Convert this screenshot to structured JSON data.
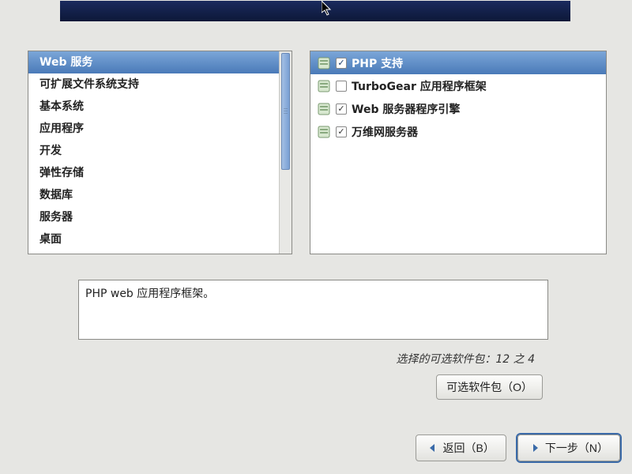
{
  "categories": [
    {
      "label": "Web 服务",
      "selected": true
    },
    {
      "label": "可扩展文件系统支持",
      "selected": false
    },
    {
      "label": "基本系统",
      "selected": false
    },
    {
      "label": "应用程序",
      "selected": false
    },
    {
      "label": "开发",
      "selected": false
    },
    {
      "label": "弹性存储",
      "selected": false
    },
    {
      "label": "数据库",
      "selected": false
    },
    {
      "label": "服务器",
      "selected": false
    },
    {
      "label": "桌面",
      "selected": false
    }
  ],
  "packages": [
    {
      "label": "PHP 支持",
      "checked": true,
      "selected": true
    },
    {
      "label": "TurboGear 应用程序框架",
      "checked": false,
      "selected": false
    },
    {
      "label": "Web 服务器程序引擎",
      "checked": true,
      "selected": false
    },
    {
      "label": "万维网服务器",
      "checked": true,
      "selected": false
    }
  ],
  "description": "PHP web 应用程序框架。",
  "status": {
    "prefix": "选择",
    "mid": "的可选软件包：",
    "count": "12 之 4"
  },
  "buttons": {
    "optional": "可选软件包（O）",
    "back": "返回（B）",
    "next": "下一步（N）"
  }
}
